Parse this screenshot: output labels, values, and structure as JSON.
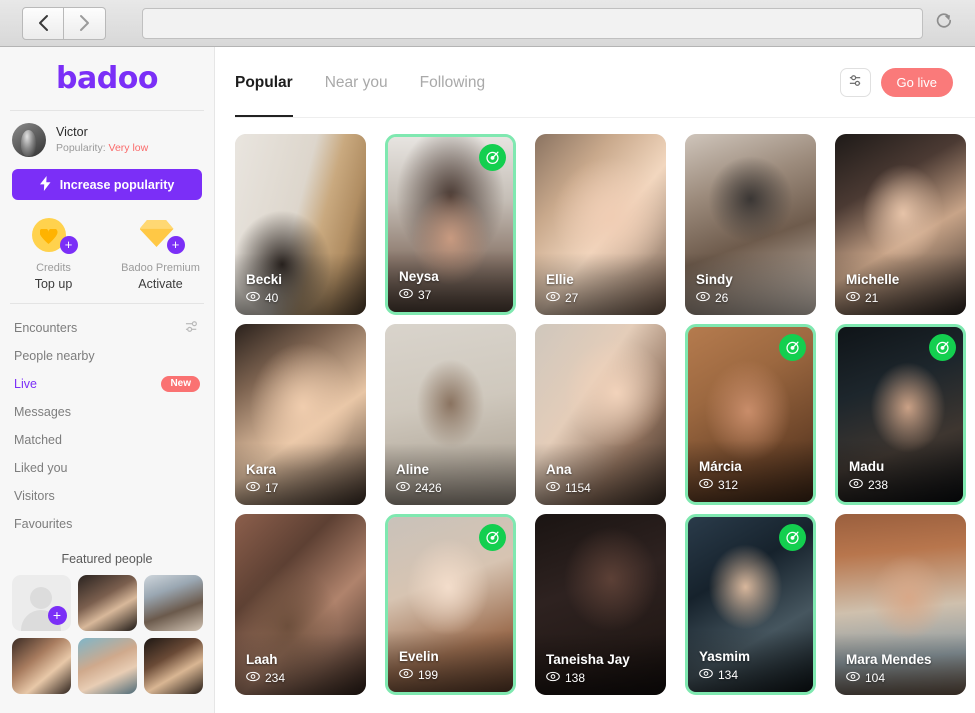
{
  "browser": {
    "back_icon": "chevron-left-icon",
    "forward_icon": "chevron-right-icon",
    "url_value": "",
    "url_placeholder": "",
    "reload_icon": "reload-icon"
  },
  "sidebar": {
    "logo": "badoo",
    "logo_color": "#7b2ff7",
    "profile": {
      "name": "Victor",
      "popularity_label": "Popularity:",
      "popularity_value": "Very low",
      "popularity_color": "#fa6b6b",
      "avatar_name": "avatar"
    },
    "increase_button": {
      "label": "Increase popularity",
      "icon": "lightning-bolt-icon",
      "color": "#7b2ff7"
    },
    "perks": [
      {
        "icon": "coin-heart-icon",
        "label": "Credits",
        "action": "Top up"
      },
      {
        "icon": "gem-icon",
        "label": "Badoo Premium",
        "action": "Activate"
      }
    ],
    "nav": [
      {
        "label": "Encounters",
        "active": false,
        "trailing": "filter-icon"
      },
      {
        "label": "People nearby",
        "active": false,
        "trailing": ""
      },
      {
        "label": "Live",
        "active": true,
        "trailing": "badge",
        "badge": "New"
      },
      {
        "label": "Messages",
        "active": false,
        "trailing": ""
      },
      {
        "label": "Matched",
        "active": false,
        "trailing": ""
      },
      {
        "label": "Liked you",
        "active": false,
        "trailing": ""
      },
      {
        "label": "Visitors",
        "active": false,
        "trailing": ""
      },
      {
        "label": "Favourites",
        "active": false,
        "trailing": ""
      }
    ],
    "featured": {
      "title": "Featured people",
      "add_label": "+",
      "cells": [
        "add",
        "f-1",
        "f-2",
        "f-3",
        "f-4",
        "f-5"
      ]
    }
  },
  "main": {
    "tabs": [
      {
        "label": "Popular",
        "active": true
      },
      {
        "label": "Near you",
        "active": false
      },
      {
        "label": "Following",
        "active": false
      }
    ],
    "filter_icon": "filter-icon",
    "go_live_label": "Go live",
    "go_live_color": "#fa7a7a",
    "live_border_color": "#7fe8b0",
    "live_badge_color": "#13cf4f",
    "live_badge_icon": "live-target-icon",
    "views_icon": "eye-icon",
    "cards": [
      {
        "name": "Becki",
        "views": "40",
        "live": false,
        "photo": "p-becki"
      },
      {
        "name": "Neysa",
        "views": "37",
        "live": true,
        "photo": "p-neysa"
      },
      {
        "name": "Ellie",
        "views": "27",
        "live": false,
        "photo": "p-ellie"
      },
      {
        "name": "Sindy",
        "views": "26",
        "live": false,
        "photo": "p-sindy"
      },
      {
        "name": "Michelle",
        "views": "21",
        "live": false,
        "photo": "p-michelle"
      },
      {
        "name": "Kara",
        "views": "17",
        "live": false,
        "photo": "p-kara"
      },
      {
        "name": "Aline",
        "views": "2426",
        "live": false,
        "photo": "p-aline"
      },
      {
        "name": "Ana",
        "views": "1154",
        "live": false,
        "photo": "p-ana"
      },
      {
        "name": "Márcia",
        "views": "312",
        "live": true,
        "photo": "p-marcia"
      },
      {
        "name": "Madu",
        "views": "238",
        "live": true,
        "photo": "p-madu"
      },
      {
        "name": "Laah",
        "views": "234",
        "live": false,
        "photo": "p-laah"
      },
      {
        "name": "Evelin",
        "views": "199",
        "live": true,
        "photo": "p-evelin"
      },
      {
        "name": "Taneisha Jay",
        "views": "138",
        "live": false,
        "photo": "p-taneisha"
      },
      {
        "name": "Yasmim",
        "views": "134",
        "live": true,
        "photo": "p-yasmim"
      },
      {
        "name": "Mara Mendes",
        "views": "104",
        "live": false,
        "photo": "p-mara"
      }
    ]
  }
}
